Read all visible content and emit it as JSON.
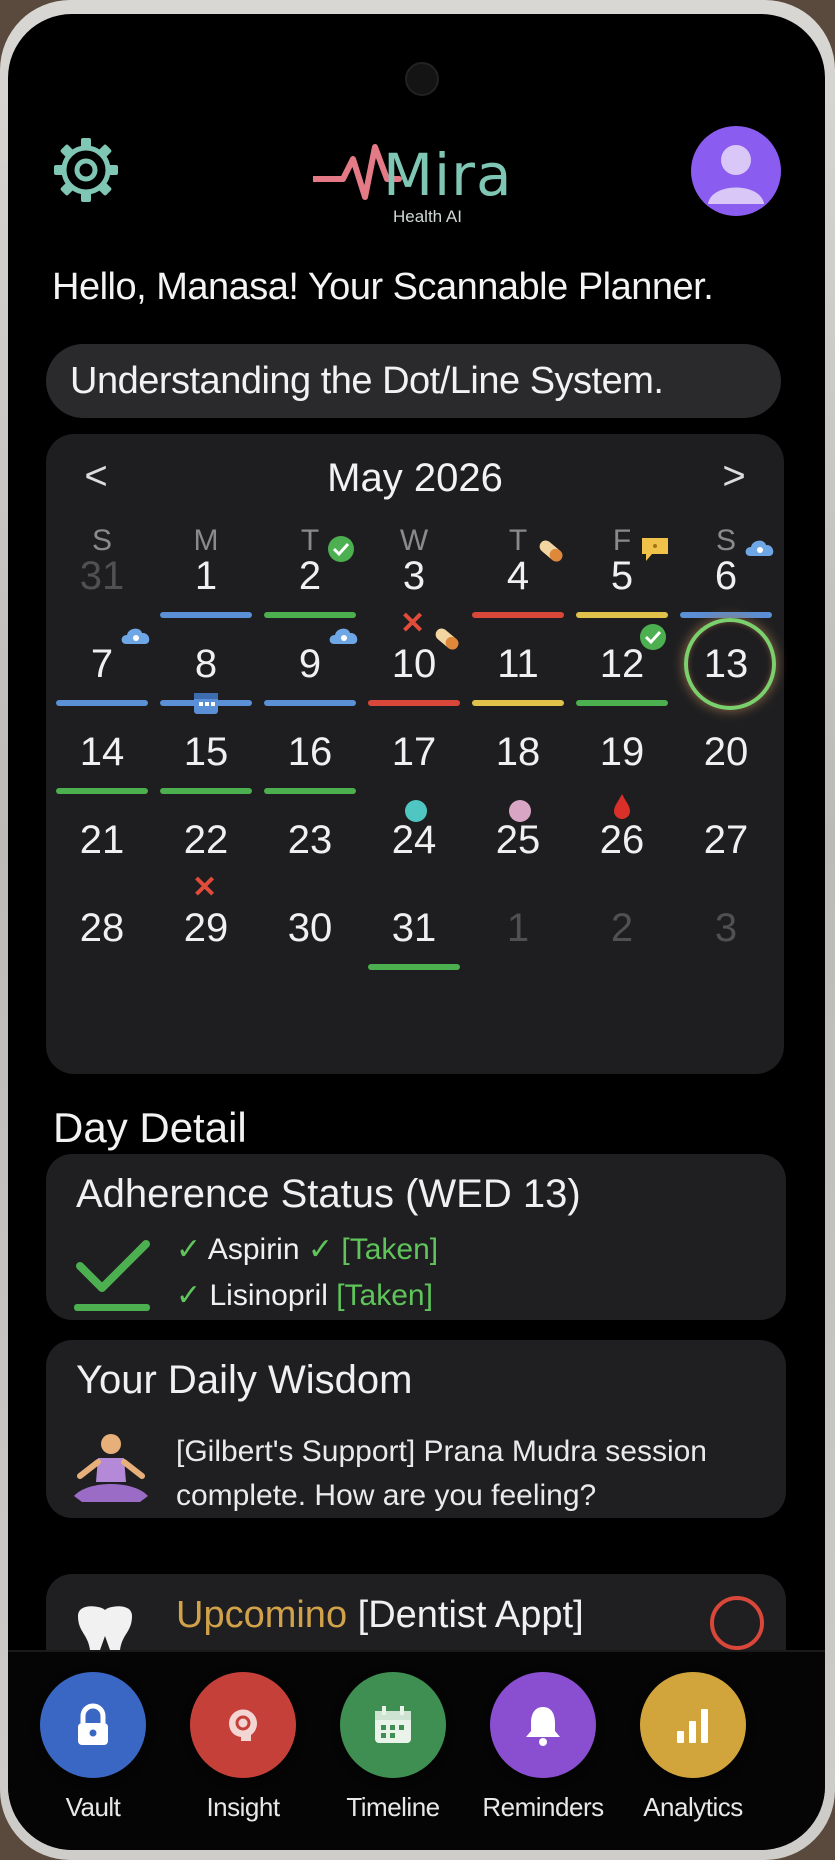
{
  "header": {
    "logo_text": "Mira",
    "logo_subtitle": "Health AI",
    "settings_icon": "gear-icon",
    "avatar_icon": "user-avatar-icon"
  },
  "greeting": "Hello, Manasa! Your Scannable Planner.",
  "system_pill": "Understanding the Dot/Line System.",
  "calendar": {
    "month_label": "May 2026",
    "prev_icon": "<",
    "next_icon": ">",
    "weekdays": [
      "S",
      "M",
      "T",
      "W",
      "T",
      "F",
      "S"
    ],
    "colors": {
      "blue": "#5b8fd6",
      "green": "#4caf50",
      "red": "#d9473a",
      "yellow": "#e0c24a",
      "teal": "#4fc6c1",
      "pink": "#d8a5c4",
      "today_ring": "#7bd06e"
    },
    "days": [
      {
        "label": "31",
        "muted": true
      },
      {
        "label": "1",
        "bar": "blue"
      },
      {
        "label": "2",
        "bar": "green",
        "badge": "check-badge-icon"
      },
      {
        "label": "3",
        "mark": "x-mark-icon"
      },
      {
        "label": "4",
        "bar": "red",
        "badge": "pill-icon"
      },
      {
        "label": "5",
        "bar": "yellow",
        "badge": "chat-bubble-icon"
      },
      {
        "label": "6",
        "bar": "blue",
        "badge": "cloud-icon"
      },
      {
        "label": "7",
        "bar": "blue",
        "badge": "cloud-icon"
      },
      {
        "label": "8",
        "bar": "blue",
        "badge": "calendar-badge-icon"
      },
      {
        "label": "9",
        "bar": "blue",
        "badge": "cloud-icon"
      },
      {
        "label": "10",
        "bar": "red",
        "badge": "pill-icon"
      },
      {
        "label": "11",
        "bar": "yellow"
      },
      {
        "label": "12",
        "bar": "green",
        "badge": "check-badge-icon"
      },
      {
        "label": "13",
        "today": true
      },
      {
        "label": "14",
        "bar": "green"
      },
      {
        "label": "15",
        "bar": "green"
      },
      {
        "label": "16",
        "bar": "green"
      },
      {
        "label": "17",
        "dot": "teal"
      },
      {
        "label": "18",
        "dot": "pink"
      },
      {
        "label": "19",
        "mark": "blood-drop-icon"
      },
      {
        "label": "20"
      },
      {
        "label": "21"
      },
      {
        "label": "22",
        "mark": "x-mark-icon"
      },
      {
        "label": "23"
      },
      {
        "label": "24"
      },
      {
        "label": "25"
      },
      {
        "label": "26"
      },
      {
        "label": "27"
      },
      {
        "label": "28"
      },
      {
        "label": "29"
      },
      {
        "label": "30"
      },
      {
        "label": "31",
        "bar": "green"
      },
      {
        "label": "1",
        "muted": true
      },
      {
        "label": "2",
        "muted": true
      },
      {
        "label": "3",
        "muted": true
      }
    ]
  },
  "day_detail": {
    "section_title": "Day Detail",
    "adherence": {
      "title": "Adherence Status (WED 13)",
      "icon": "big-check-icon",
      "meds": [
        {
          "check": "✓",
          "name": "Aspirin",
          "extra": "✓",
          "status": "[Taken]"
        },
        {
          "check": "✓",
          "name": "Lisinopril",
          "extra": "",
          "status": "[Taken]"
        }
      ]
    },
    "wisdom": {
      "title": "Your Daily Wisdom",
      "icon": "meditation-icon",
      "text": "[Gilbert's Support] Prana Mudra session complete. How are you feeling?"
    },
    "upcoming": {
      "icon": "tooth-icon",
      "label": "Upcomino",
      "detail": "[Dentist Appt]"
    }
  },
  "nav": {
    "items": [
      {
        "label": "Vault",
        "icon": "lock-icon",
        "color": "#3a67c4"
      },
      {
        "label": "Insight",
        "icon": "brain-bulb-icon",
        "color": "#c6403a"
      },
      {
        "label": "Timeline",
        "icon": "calendar-icon",
        "color": "#3f8f52"
      },
      {
        "label": "Reminders",
        "icon": "bell-icon",
        "color": "#8a4fd0"
      },
      {
        "label": "Analytics",
        "icon": "bar-chart-icon",
        "color": "#d2a53c"
      }
    ]
  }
}
